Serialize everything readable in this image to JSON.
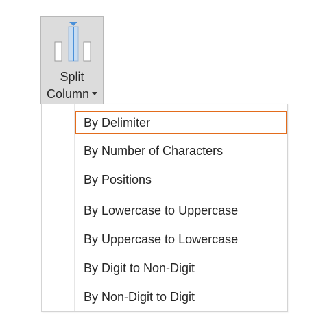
{
  "ribbon_button": {
    "label_line1": "Split",
    "label_line2": "Column",
    "icon": "split-column-icon",
    "caret_icon": "caret-down-icon"
  },
  "menu": {
    "items": [
      {
        "label": "By Delimiter",
        "highlighted": true
      },
      {
        "label": "By Number of Characters"
      },
      {
        "label": "By Positions"
      },
      {
        "label": "By Lowercase to Uppercase"
      },
      {
        "label": "By Uppercase to Lowercase"
      },
      {
        "label": "By Digit to Non-Digit"
      },
      {
        "label": "By Non-Digit to Digit"
      }
    ]
  },
  "colors": {
    "button_bg": "#dcdcdc",
    "highlight_border": "#e36c1c",
    "icon_accent": "#4a90d9",
    "text": "#262626"
  }
}
